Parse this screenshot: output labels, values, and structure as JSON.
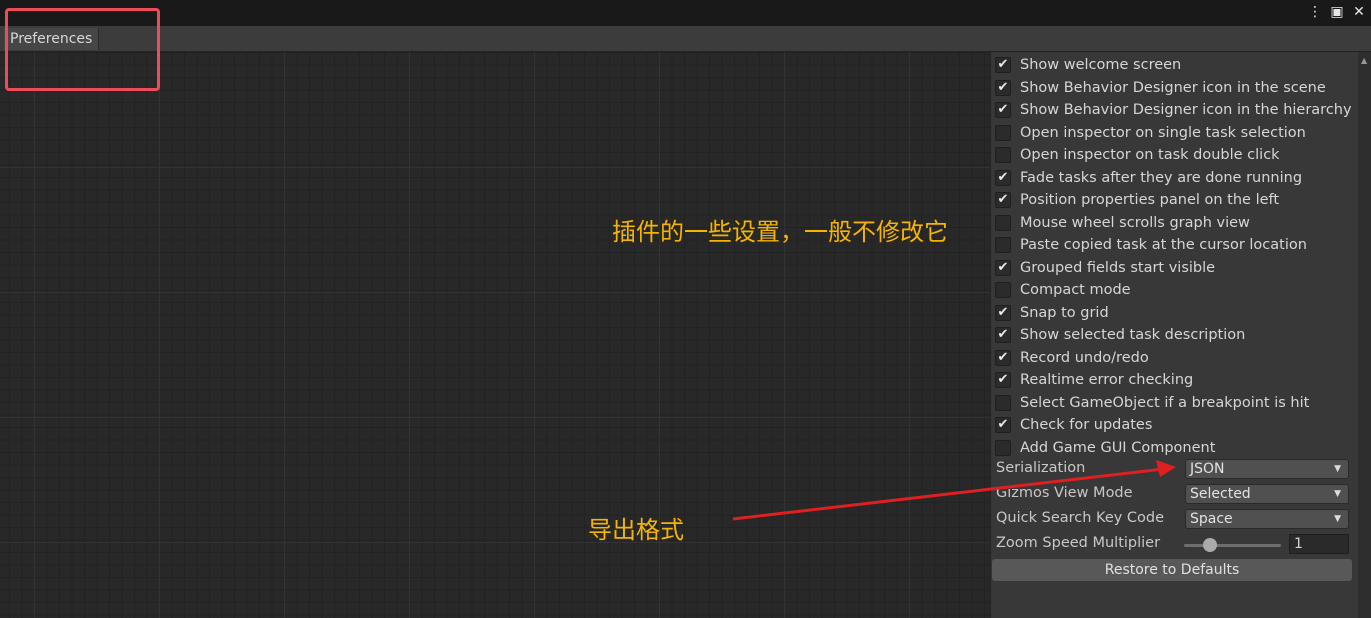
{
  "window": {
    "tab_label": "Preferences",
    "controls": [
      {
        "name": "more-icon",
        "glyph": "⋮"
      },
      {
        "name": "maximize-icon",
        "glyph": "▣"
      },
      {
        "name": "close-icon",
        "glyph": "✕"
      }
    ]
  },
  "annotations": {
    "settings_note": "插件的一些设置，一般不修改它",
    "export_note": "导出格式",
    "accent_color": "#f4b400",
    "highlight_color": "#ef4b5c",
    "arrow_color": "#e02020"
  },
  "preferences": {
    "options": [
      {
        "label": "Show welcome screen",
        "checked": true
      },
      {
        "label": "Show Behavior Designer icon in the scene",
        "checked": true
      },
      {
        "label": "Show Behavior Designer icon in the hierarchy",
        "checked": true
      },
      {
        "label": "Open inspector on single task selection",
        "checked": false
      },
      {
        "label": "Open inspector on task double click",
        "checked": false
      },
      {
        "label": "Fade tasks after they are done running",
        "checked": true
      },
      {
        "label": "Position properties panel on the left",
        "checked": true
      },
      {
        "label": "Mouse wheel scrolls graph view",
        "checked": false
      },
      {
        "label": "Paste copied task at the cursor location",
        "checked": false
      },
      {
        "label": "Grouped fields start visible",
        "checked": true
      },
      {
        "label": "Compact mode",
        "checked": false
      },
      {
        "label": "Snap to grid",
        "checked": true
      },
      {
        "label": "Show selected task description",
        "checked": true
      },
      {
        "label": "Record undo/redo",
        "checked": true
      },
      {
        "label": "Realtime error checking",
        "checked": true
      },
      {
        "label": "Select GameObject if a breakpoint is hit",
        "checked": false
      },
      {
        "label": "Check for updates",
        "checked": true
      },
      {
        "label": "Add Game GUI Component",
        "checked": false
      }
    ],
    "serialization": {
      "label": "Serialization",
      "value": "JSON"
    },
    "gizmos_view_mode": {
      "label": "Gizmos View Mode",
      "value": "Selected"
    },
    "quick_search_key": {
      "label": "Quick Search Key Code",
      "value": "Space"
    },
    "zoom_speed": {
      "label": "Zoom Speed Multiplier",
      "value": "1"
    },
    "restore_label": "Restore to Defaults"
  }
}
